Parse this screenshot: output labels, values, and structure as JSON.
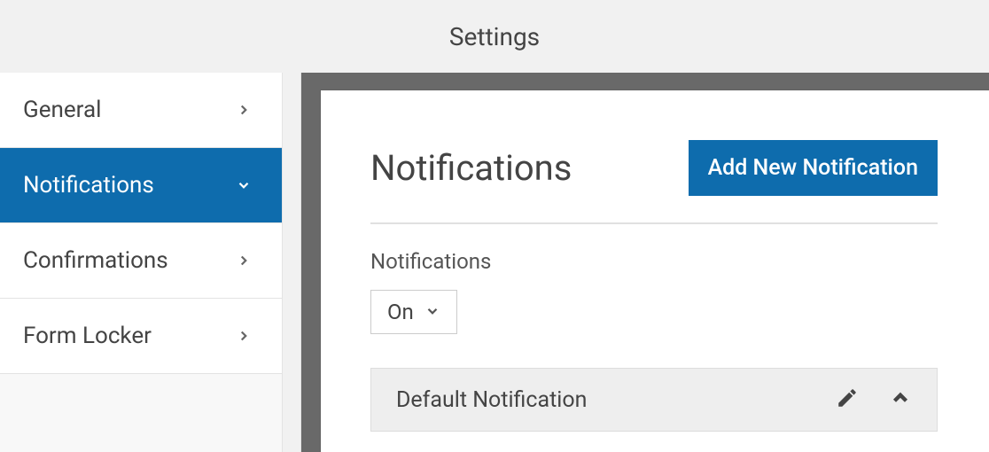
{
  "header": {
    "title": "Settings"
  },
  "sidebar": {
    "items": [
      {
        "label": "General",
        "active": false
      },
      {
        "label": "Notifications",
        "active": true
      },
      {
        "label": "Confirmations",
        "active": false
      },
      {
        "label": "Form Locker",
        "active": false
      }
    ]
  },
  "panel": {
    "title": "Notifications",
    "add_button_label": "Add New Notification",
    "section_label": "Notifications",
    "select_value": "On",
    "row_name": "Default Notification"
  }
}
